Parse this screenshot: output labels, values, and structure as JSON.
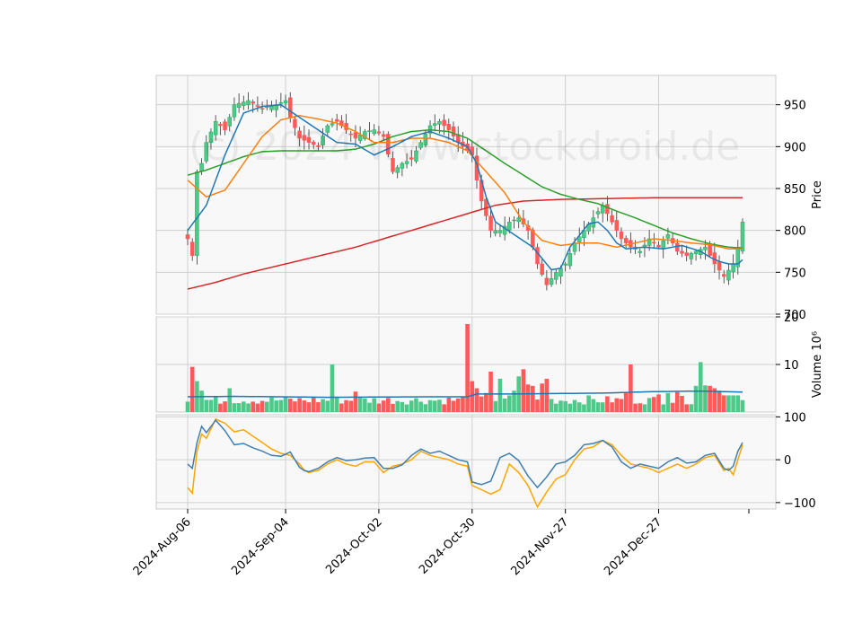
{
  "watermark": "(c) 2024 www.stockdroid.de",
  "chart_data": {
    "type": "candlestick",
    "x_tick_labels": [
      "2024-Aug-06",
      "2024-Sep-04",
      "2024-Oct-02",
      "2024-Oct-30",
      "2024-Nov-27",
      "2024-Dec-27"
    ],
    "x_tick_index": [
      0,
      21,
      41,
      61,
      81,
      101
    ],
    "n_bars": 120,
    "price_panel": {
      "ylabel": "Price",
      "ylim": [
        700,
        985
      ],
      "yticks": [
        700,
        750,
        800,
        850,
        900,
        950
      ],
      "close_knots": [
        [
          0,
          790
        ],
        [
          1,
          770
        ],
        [
          2,
          870
        ],
        [
          3,
          880
        ],
        [
          4,
          905
        ],
        [
          6,
          930
        ],
        [
          8,
          920
        ],
        [
          10,
          950
        ],
        [
          13,
          955
        ],
        [
          16,
          945
        ],
        [
          19,
          950
        ],
        [
          21,
          955
        ],
        [
          22,
          935
        ],
        [
          24,
          910
        ],
        [
          26,
          905
        ],
        [
          28,
          900
        ],
        [
          30,
          925
        ],
        [
          32,
          930
        ],
        [
          34,
          920
        ],
        [
          36,
          910
        ],
        [
          38,
          918
        ],
        [
          40,
          920
        ],
        [
          42,
          912
        ],
        [
          44,
          870
        ],
        [
          46,
          880
        ],
        [
          48,
          885
        ],
        [
          50,
          905
        ],
        [
          52,
          925
        ],
        [
          54,
          930
        ],
        [
          56,
          920
        ],
        [
          58,
          905
        ],
        [
          60,
          895
        ],
        [
          61,
          890
        ],
        [
          62,
          860
        ],
        [
          63,
          835
        ],
        [
          65,
          800
        ],
        [
          67,
          800
        ],
        [
          69,
          810
        ],
        [
          71,
          815
        ],
        [
          73,
          800
        ],
        [
          75,
          760
        ],
        [
          77,
          735
        ],
        [
          79,
          750
        ],
        [
          81,
          760
        ],
        [
          83,
          785
        ],
        [
          85,
          800
        ],
        [
          87,
          815
        ],
        [
          89,
          830
        ],
        [
          91,
          810
        ],
        [
          93,
          790
        ],
        [
          95,
          780
        ],
        [
          97,
          775
        ],
        [
          99,
          790
        ],
        [
          101,
          780
        ],
        [
          103,
          795
        ],
        [
          105,
          775
        ],
        [
          107,
          770
        ],
        [
          109,
          775
        ],
        [
          111,
          780
        ],
        [
          113,
          760
        ],
        [
          115,
          745
        ],
        [
          117,
          760
        ],
        [
          118,
          780
        ],
        [
          119,
          810
        ]
      ],
      "ma_10": [
        [
          0,
          800
        ],
        [
          4,
          830
        ],
        [
          8,
          890
        ],
        [
          12,
          940
        ],
        [
          16,
          948
        ],
        [
          20,
          950
        ],
        [
          24,
          935
        ],
        [
          28,
          920
        ],
        [
          32,
          905
        ],
        [
          36,
          903
        ],
        [
          40,
          890
        ],
        [
          44,
          900
        ],
        [
          48,
          912
        ],
        [
          52,
          918
        ],
        [
          56,
          910
        ],
        [
          60,
          900
        ],
        [
          62,
          880
        ],
        [
          64,
          840
        ],
        [
          66,
          810
        ],
        [
          70,
          795
        ],
        [
          74,
          780
        ],
        [
          78,
          753
        ],
        [
          80,
          755
        ],
        [
          82,
          780
        ],
        [
          86,
          808
        ],
        [
          88,
          810
        ],
        [
          90,
          800
        ],
        [
          92,
          785
        ],
        [
          94,
          778
        ],
        [
          98,
          780
        ],
        [
          102,
          778
        ],
        [
          106,
          782
        ],
        [
          110,
          775
        ],
        [
          112,
          768
        ],
        [
          114,
          763
        ],
        [
          116,
          760
        ],
        [
          118,
          760
        ],
        [
          119,
          765
        ]
      ],
      "ma_20": [
        [
          0,
          860
        ],
        [
          4,
          840
        ],
        [
          8,
          848
        ],
        [
          12,
          880
        ],
        [
          16,
          912
        ],
        [
          20,
          932
        ],
        [
          24,
          937
        ],
        [
          28,
          933
        ],
        [
          32,
          928
        ],
        [
          36,
          918
        ],
        [
          40,
          905
        ],
        [
          44,
          905
        ],
        [
          48,
          910
        ],
        [
          52,
          910
        ],
        [
          56,
          905
        ],
        [
          60,
          895
        ],
        [
          64,
          870
        ],
        [
          68,
          845
        ],
        [
          72,
          810
        ],
        [
          76,
          788
        ],
        [
          80,
          782
        ],
        [
          84,
          785
        ],
        [
          88,
          785
        ],
        [
          92,
          780
        ],
        [
          96,
          785
        ],
        [
          100,
          790
        ],
        [
          104,
          788
        ],
        [
          108,
          785
        ],
        [
          112,
          783
        ],
        [
          116,
          778
        ],
        [
          119,
          778
        ]
      ],
      "ma_50": [
        [
          0,
          866
        ],
        [
          4,
          872
        ],
        [
          8,
          880
        ],
        [
          12,
          888
        ],
        [
          16,
          894
        ],
        [
          20,
          895
        ],
        [
          24,
          895
        ],
        [
          28,
          895
        ],
        [
          32,
          895
        ],
        [
          36,
          897
        ],
        [
          40,
          903
        ],
        [
          44,
          912
        ],
        [
          48,
          918
        ],
        [
          52,
          920
        ],
        [
          56,
          918
        ],
        [
          60,
          910
        ],
        [
          64,
          895
        ],
        [
          68,
          880
        ],
        [
          72,
          866
        ],
        [
          76,
          852
        ],
        [
          80,
          843
        ],
        [
          84,
          837
        ],
        [
          88,
          832
        ],
        [
          92,
          823
        ],
        [
          96,
          815
        ],
        [
          100,
          806
        ],
        [
          104,
          797
        ],
        [
          108,
          790
        ],
        [
          112,
          784
        ],
        [
          116,
          780
        ],
        [
          119,
          779
        ]
      ],
      "ma_200": [
        [
          0,
          730
        ],
        [
          6,
          738
        ],
        [
          12,
          748
        ],
        [
          18,
          756
        ],
        [
          24,
          764
        ],
        [
          30,
          772
        ],
        [
          36,
          780
        ],
        [
          42,
          790
        ],
        [
          48,
          800
        ],
        [
          54,
          810
        ],
        [
          60,
          820
        ],
        [
          66,
          830
        ],
        [
          72,
          835
        ],
        [
          80,
          837
        ],
        [
          90,
          838
        ],
        [
          100,
          839
        ],
        [
          110,
          839
        ],
        [
          119,
          839
        ]
      ]
    },
    "volume_panel": {
      "ylabel": "Volume  10⁶",
      "ylim": [
        0,
        20
      ],
      "yticks": [
        10,
        20
      ],
      "spikes": {
        "1": 9.5,
        "2": 6.5,
        "3": 4.5,
        "9": 5,
        "31": 10,
        "36": 4.3,
        "59": 3.2,
        "60": 18.5,
        "61": 6.5,
        "62": 5,
        "64": 4,
        "65": 8.5,
        "67": 7,
        "69": 3.5,
        "70": 4.5,
        "71": 7.5,
        "72": 9,
        "73": 5.8,
        "74": 5.5,
        "76": 6,
        "77": 7,
        "86": 3.5,
        "94": 4,
        "95": 10,
        "101": 3.7,
        "103": 4,
        "105": 4.2,
        "109": 5.5,
        "110": 10.5,
        "111": 5.6,
        "112": 5.5,
        "113": 5,
        "114": 4.5,
        "115": 3.5,
        "116": 3.5,
        "117": 3.5,
        "118": 3.5,
        "119": 2.5
      },
      "ma_knots": [
        [
          0,
          3.2
        ],
        [
          10,
          3.3
        ],
        [
          30,
          3.1
        ],
        [
          50,
          3.2
        ],
        [
          60,
          3.2
        ],
        [
          62,
          3.8
        ],
        [
          70,
          3.8
        ],
        [
          80,
          3.9
        ],
        [
          90,
          4.0
        ],
        [
          100,
          4.3
        ],
        [
          110,
          4.4
        ],
        [
          119,
          4.2
        ]
      ]
    },
    "oscillator_panel": {
      "ylim": [
        -115,
        105
      ],
      "yticks": [
        -100,
        0,
        100
      ],
      "line_1": [
        [
          0,
          -10
        ],
        [
          1,
          -20
        ],
        [
          2,
          40
        ],
        [
          3,
          78
        ],
        [
          4,
          63
        ],
        [
          6,
          92
        ],
        [
          8,
          68
        ],
        [
          10,
          35
        ],
        [
          12,
          38
        ],
        [
          14,
          28
        ],
        [
          16,
          20
        ],
        [
          18,
          10
        ],
        [
          20,
          8
        ],
        [
          22,
          18
        ],
        [
          24,
          -18
        ],
        [
          25,
          -25
        ],
        [
          26,
          -28
        ],
        [
          28,
          -20
        ],
        [
          30,
          -5
        ],
        [
          32,
          5
        ],
        [
          34,
          -2
        ],
        [
          36,
          0
        ],
        [
          38,
          4
        ],
        [
          40,
          5
        ],
        [
          42,
          -20
        ],
        [
          44,
          -20
        ],
        [
          46,
          -12
        ],
        [
          48,
          10
        ],
        [
          50,
          25
        ],
        [
          52,
          15
        ],
        [
          54,
          20
        ],
        [
          56,
          10
        ],
        [
          58,
          0
        ],
        [
          60,
          -5
        ],
        [
          61,
          -52
        ],
        [
          63,
          -58
        ],
        [
          65,
          -50
        ],
        [
          67,
          5
        ],
        [
          69,
          15
        ],
        [
          71,
          -2
        ],
        [
          73,
          -38
        ],
        [
          75,
          -65
        ],
        [
          77,
          -40
        ],
        [
          79,
          -10
        ],
        [
          81,
          -5
        ],
        [
          83,
          10
        ],
        [
          85,
          35
        ],
        [
          87,
          38
        ],
        [
          89,
          45
        ],
        [
          91,
          30
        ],
        [
          93,
          -5
        ],
        [
          95,
          -20
        ],
        [
          97,
          -10
        ],
        [
          99,
          -15
        ],
        [
          101,
          -20
        ],
        [
          103,
          -5
        ],
        [
          105,
          5
        ],
        [
          107,
          -8
        ],
        [
          109,
          -5
        ],
        [
          111,
          10
        ],
        [
          113,
          15
        ],
        [
          115,
          -20
        ],
        [
          116,
          -25
        ],
        [
          117,
          -15
        ],
        [
          118,
          20
        ],
        [
          119,
          40
        ]
      ],
      "line_2": [
        [
          0,
          -65
        ],
        [
          1,
          -78
        ],
        [
          2,
          20
        ],
        [
          3,
          60
        ],
        [
          4,
          50
        ],
        [
          6,
          95
        ],
        [
          8,
          85
        ],
        [
          10,
          65
        ],
        [
          12,
          70
        ],
        [
          14,
          55
        ],
        [
          16,
          40
        ],
        [
          18,
          25
        ],
        [
          20,
          15
        ],
        [
          22,
          10
        ],
        [
          24,
          -10
        ],
        [
          25,
          -25
        ],
        [
          26,
          -30
        ],
        [
          28,
          -25
        ],
        [
          30,
          -10
        ],
        [
          32,
          0
        ],
        [
          34,
          -10
        ],
        [
          36,
          -15
        ],
        [
          38,
          -5
        ],
        [
          40,
          -5
        ],
        [
          42,
          -30
        ],
        [
          44,
          -15
        ],
        [
          46,
          -10
        ],
        [
          48,
          0
        ],
        [
          50,
          20
        ],
        [
          52,
          10
        ],
        [
          54,
          5
        ],
        [
          56,
          0
        ],
        [
          58,
          -10
        ],
        [
          60,
          -15
        ],
        [
          61,
          -60
        ],
        [
          63,
          -70
        ],
        [
          65,
          -80
        ],
        [
          67,
          -70
        ],
        [
          69,
          -10
        ],
        [
          71,
          -30
        ],
        [
          73,
          -60
        ],
        [
          75,
          -110
        ],
        [
          77,
          -75
        ],
        [
          79,
          -45
        ],
        [
          81,
          -35
        ],
        [
          83,
          0
        ],
        [
          85,
          25
        ],
        [
          87,
          30
        ],
        [
          89,
          45
        ],
        [
          91,
          35
        ],
        [
          93,
          10
        ],
        [
          95,
          -10
        ],
        [
          97,
          -15
        ],
        [
          99,
          -20
        ],
        [
          101,
          -30
        ],
        [
          103,
          -20
        ],
        [
          105,
          -10
        ],
        [
          107,
          -20
        ],
        [
          109,
          -10
        ],
        [
          111,
          5
        ],
        [
          113,
          10
        ],
        [
          115,
          -25
        ],
        [
          116,
          -20
        ],
        [
          117,
          -35
        ],
        [
          118,
          0
        ],
        [
          119,
          35
        ]
      ]
    }
  }
}
